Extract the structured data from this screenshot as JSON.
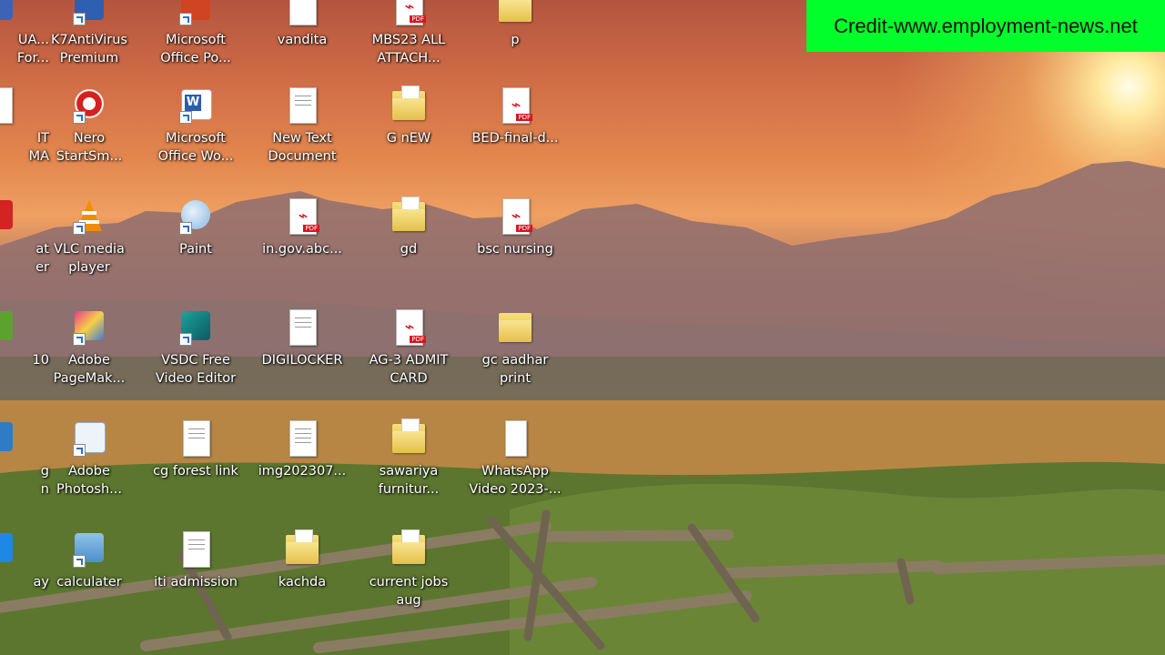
{
  "credit": "Credit-www.employment-news.net",
  "desktop": {
    "icons": [
      {
        "label": "UA...\nFor...",
        "type": "app"
      },
      {
        "label": "K7AntiVirus\nPremium",
        "type": "app"
      },
      {
        "label": "Microsoft\nOffice Po...",
        "type": "app"
      },
      {
        "label": "vandita",
        "type": "doc"
      },
      {
        "label": "MBS23 ALL\nATTACH...",
        "type": "pdf"
      },
      {
        "label": "p",
        "type": "folder"
      },
      {
        "label": "IT\nMA",
        "type": "doc"
      },
      {
        "label": "Nero\nStartSm...",
        "type": "app"
      },
      {
        "label": "Microsoft\nOffice Wo...",
        "type": "app"
      },
      {
        "label": "New Text\nDocument",
        "type": "doc"
      },
      {
        "label": "G nEW",
        "type": "folder"
      },
      {
        "label": "BED-final-d...",
        "type": "pdf"
      },
      {
        "label": "at\ner",
        "type": "app"
      },
      {
        "label": "VLC media\nplayer",
        "type": "app"
      },
      {
        "label": "Paint",
        "type": "app"
      },
      {
        "label": "in.gov.abc...",
        "type": "pdf"
      },
      {
        "label": "gd",
        "type": "folder"
      },
      {
        "label": "bsc nursing",
        "type": "pdf"
      },
      {
        "label": "10",
        "type": "app"
      },
      {
        "label": "Adobe\nPageMak...",
        "type": "app"
      },
      {
        "label": "VSDC Free\nVideo Editor",
        "type": "app"
      },
      {
        "label": "DIGILOCKER",
        "type": "doc"
      },
      {
        "label": "AG-3 ADMIT\nCARD",
        "type": "pdf"
      },
      {
        "label": "gc aadhar\nprint",
        "type": "folder"
      },
      {
        "label": "g\nn",
        "type": "app"
      },
      {
        "label": "Adobe\nPhotosh...",
        "type": "app"
      },
      {
        "label": "cg forest link",
        "type": "doc"
      },
      {
        "label": "img202307...",
        "type": "doc"
      },
      {
        "label": "sawariya\nfurnitur...",
        "type": "folder"
      },
      {
        "label": "WhatsApp\nVideo 2023-...",
        "type": "doc"
      },
      {
        "label": "ay",
        "type": "app"
      },
      {
        "label": "calculater",
        "type": "app"
      },
      {
        "label": "iti admission",
        "type": "doc"
      },
      {
        "label": "kachda",
        "type": "folder"
      },
      {
        "label": "current jobs\naug",
        "type": "folder"
      }
    ],
    "pdf_tag": "PDF"
  }
}
